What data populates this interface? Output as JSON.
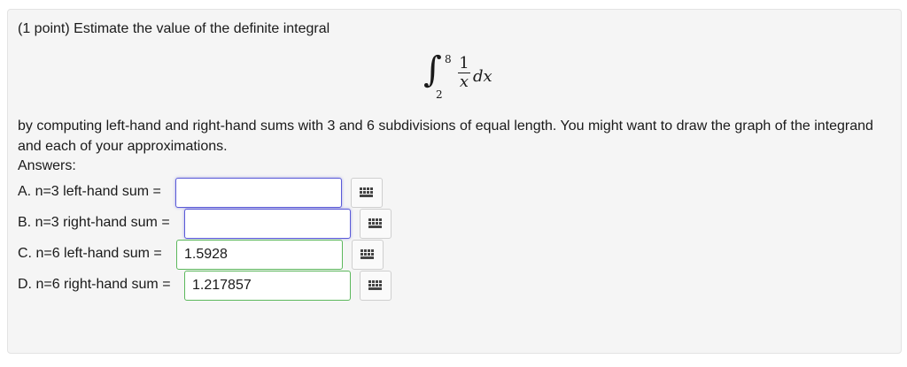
{
  "question": {
    "prompt": "(1 point) Estimate the value of the definite integral",
    "integral": {
      "lower": "2",
      "upper": "8",
      "numerator": "1",
      "denominator": "x",
      "differential": "dx"
    },
    "body": "by computing left-hand and right-hand sums with 3 and 6 subdivisions of equal length. You might want to draw the graph of the integrand and each of your approximations.",
    "answers_label": "Answers:"
  },
  "answers": [
    {
      "label": "A. n=3 left-hand sum =",
      "value": ""
    },
    {
      "label": "B. n=3 right-hand sum =",
      "value": ""
    },
    {
      "label": "C. n=6 left-hand sum =",
      "value": "1.5928"
    },
    {
      "label": "D. n=6 right-hand sum =",
      "value": "1.217857"
    }
  ],
  "icons": {
    "grid_button": "keypad-grid-icon"
  },
  "colors": {
    "focus_border": "#5a5ad8",
    "correct_border": "#5cb85c"
  }
}
